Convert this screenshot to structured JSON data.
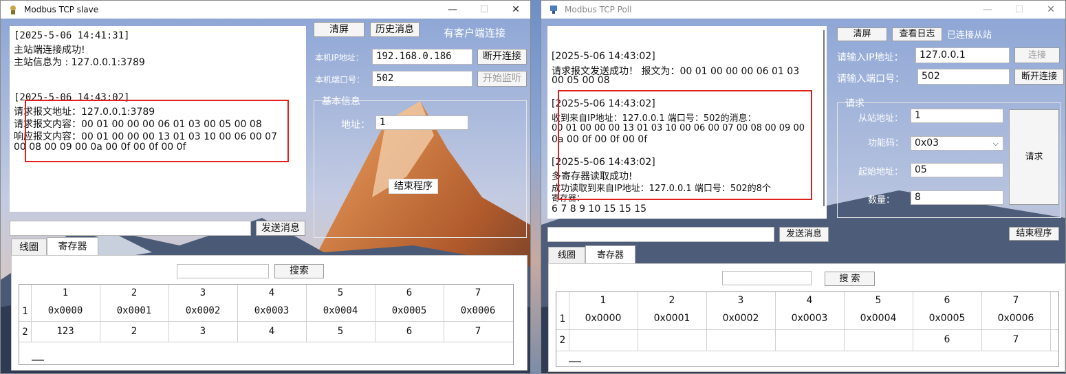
{
  "slave": {
    "title": "Modbus TCP slave",
    "controls": {
      "minimize": "—",
      "maximize": "☐",
      "close": "✕"
    },
    "clear_btn": "清屏",
    "history_btn": "历史消息",
    "client_status": "有客户端连接",
    "ip_label": "本机IP地址：",
    "ip_value": "192.168.0.186",
    "disconnect_btn": "断开连接",
    "port_label": "本机端口号：",
    "port_value": "502",
    "listen_btn": "开始监听",
    "info_group": "基本信息",
    "address_label": "地址：",
    "address_value": "1",
    "exit_btn": "结束程序",
    "send_input": "",
    "send_btn": "发送消息",
    "log": [
      "[2025-5-06 14:41:31]",
      "主站端连接成功!",
      "主站信息为 : 127.0.0.1:3789",
      "",
      "[2025-5-06 14:43:02]",
      "请求报文地址：127.0.0.1:3789",
      "请求报文内容：00 01 00 00 00 06 01 03 00 05 00 08",
      "响应报文内容：00 01 00 00 00 13 01 03 10 00 06 00 07",
      "00 08 00 09 00 0a 00 0f 00 0f 00 0f"
    ],
    "tabs": [
      "线圈",
      "寄存器"
    ],
    "search_input": "",
    "search_btn": "搜索",
    "table": {
      "headers": [
        "1",
        "2",
        "3",
        "4",
        "5",
        "6",
        "7"
      ],
      "rows": [
        {
          "label": "1",
          "cells": [
            "0x0000",
            "0x0001",
            "0x0002",
            "0x0003",
            "0x0004",
            "0x0005",
            "0x0006"
          ]
        },
        {
          "label": "2",
          "cells": [
            "123",
            "2",
            "3",
            "4",
            "5",
            "6",
            "7"
          ]
        }
      ]
    }
  },
  "poll": {
    "title": "Modbus TCP Poll",
    "controls": {
      "minimize": "—",
      "maximize": "☐",
      "close": "✕"
    },
    "clear_btn": "清屏",
    "log_btn": "查看日志",
    "status": "已连接从站",
    "ip_label": "请输入IP地址：",
    "ip_value": "127.0.0.1",
    "connect_btn": "连接",
    "port_label": "请输入端口号：",
    "port_value": "502",
    "disconnect_btn": "断开连接",
    "request_group": "请求",
    "slave_addr_label": "从站地址：",
    "slave_addr_value": "1",
    "func_label": "功能码：",
    "func_value": "0x03",
    "start_label": "起始地址：",
    "start_value": "05",
    "count_label": "数量：",
    "count_value": "8",
    "request_btn": "请求",
    "send_input": "",
    "send_btn": "发送消息",
    "exit_btn": "结束程序",
    "log": [
      "[2025-5-06 14:43:02]",
      "请求报文发送成功！ 报文为：00 01 00 00 00 06 01 03",
      "00 05 00 08",
      "",
      "[2025-5-06 14:43:02]",
      "收到来自IP地址：127.0.0.1 端口号：502的消息：",
      "00 01 00 00 00 13 01 03 10 00 06 00 07 00 08 00 09 00",
      "0a 00 0f 00 0f 00 0f",
      "",
      "[2025-5-06 14:43:02]",
      "多寄存器读取成功!",
      "成功读取到来自IP地址：127.0.0.1 端口号：502的8个",
      "寄存器：",
      "6 7 8 9 10 15 15 15"
    ],
    "tabs": [
      "线圈",
      "寄存器"
    ],
    "search_input": "",
    "search_btn": "搜 索",
    "table": {
      "headers": [
        "1",
        "2",
        "3",
        "4",
        "5",
        "6",
        "7"
      ],
      "rows": [
        {
          "label": "1",
          "cells": [
            "0x0000",
            "0x0001",
            "0x0002",
            "0x0003",
            "0x0004",
            "0x0005",
            "0x0006"
          ]
        },
        {
          "label": "2",
          "cells": [
            "",
            "",
            "",
            "",
            "",
            "6",
            "7"
          ]
        }
      ]
    }
  }
}
